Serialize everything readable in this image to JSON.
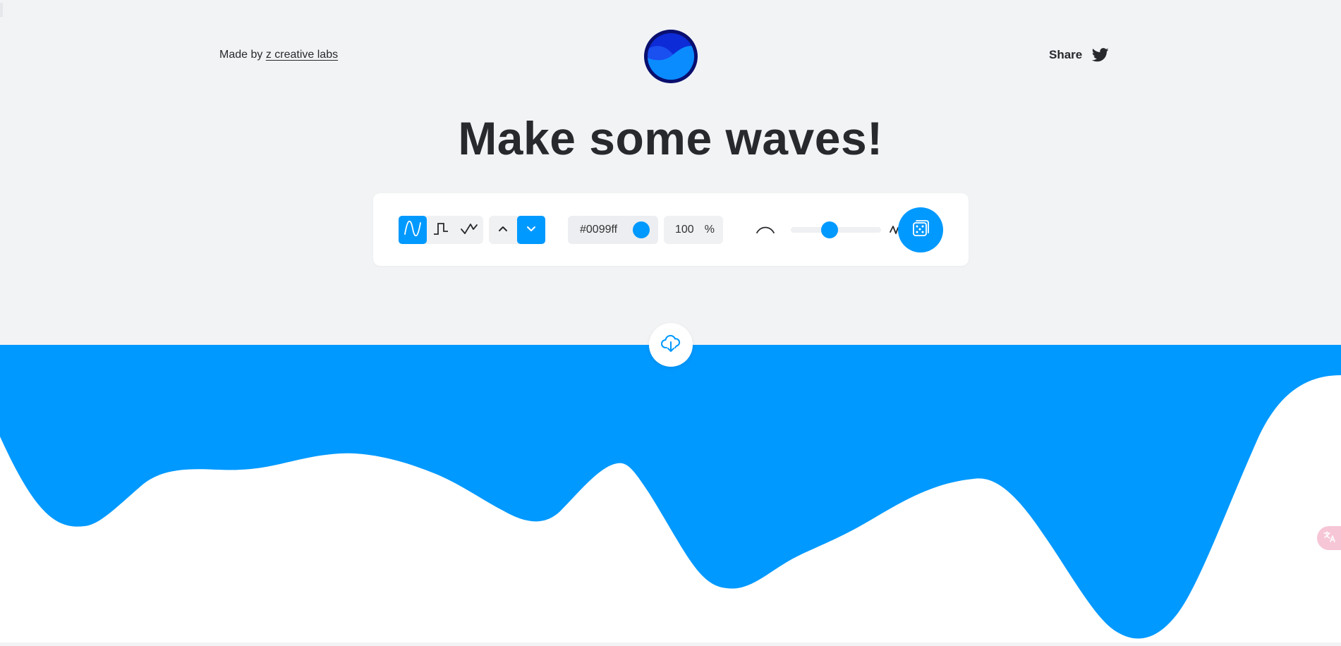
{
  "header": {
    "made_by_prefix": "Made by",
    "made_by_link": "z creative labs",
    "share_label": "Share"
  },
  "title": "Make some waves!",
  "toolbar": {
    "wave_types": [
      {
        "name": "sine",
        "icon": "sine-wave-icon",
        "selected": true
      },
      {
        "name": "square",
        "icon": "square-wave-icon",
        "selected": false
      },
      {
        "name": "triangle",
        "icon": "triangle-wave-icon",
        "selected": false
      }
    ],
    "directions": [
      {
        "name": "up",
        "icon": "chevron-up-icon",
        "selected": false
      },
      {
        "name": "down",
        "icon": "chevron-down-icon",
        "selected": true
      }
    ],
    "color_value": "#0099ff",
    "opacity_value": "100",
    "opacity_unit": "%",
    "complexity_level": 0.43,
    "complexity_min_icon": "gentle-curve-icon",
    "complexity_max_icon": "jagged-wave-icon",
    "randomize_icon": "dice-icon"
  },
  "download_icon": "cloud-download-icon",
  "colors": {
    "accent": "#0099ff",
    "background": "#f2f3f5",
    "text": "#28292d",
    "logo_dark": "#0a0f6e"
  }
}
